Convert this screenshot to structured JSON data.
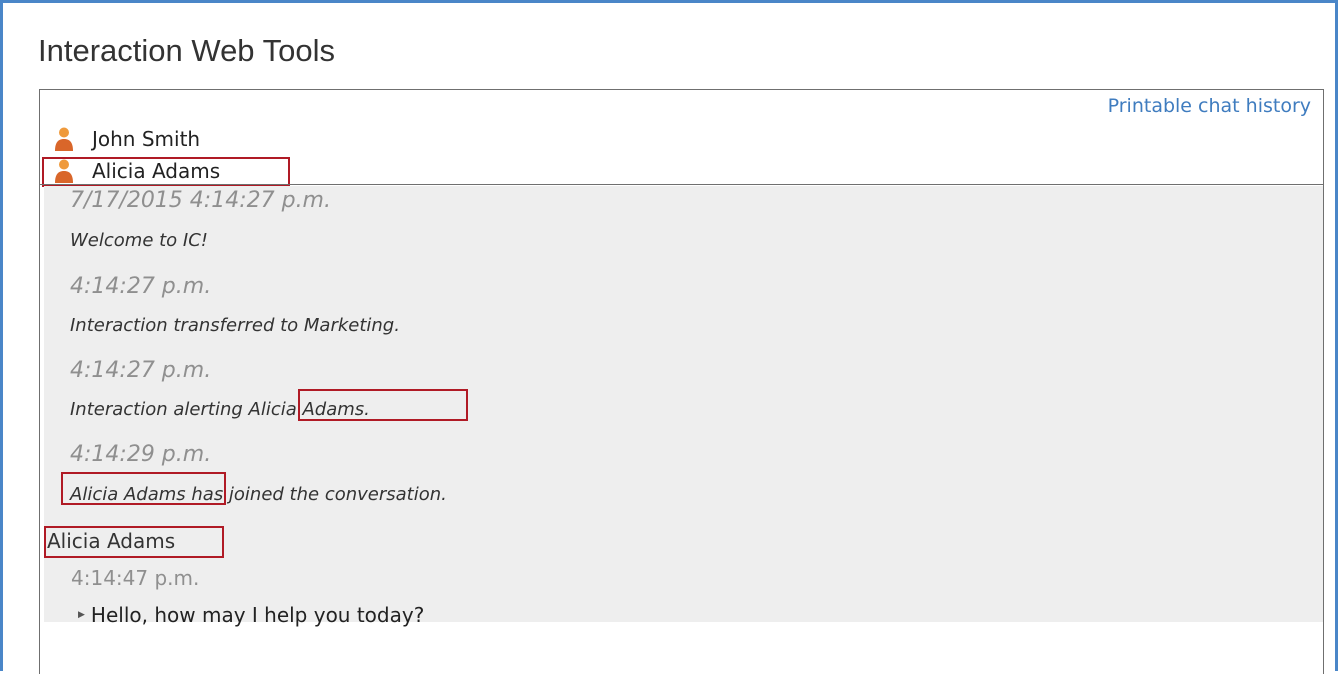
{
  "app": {
    "title": "Interaction Web Tools"
  },
  "toolbar": {
    "print_link": "Printable chat history"
  },
  "participants": [
    {
      "name": "John Smith",
      "icon": "person-icon"
    },
    {
      "name": "Alicia Adams",
      "icon": "person-icon"
    }
  ],
  "system_messages": [
    {
      "time": "7/17/2015 4:14:27 p.m.",
      "text": "Welcome to IC!"
    },
    {
      "time": "4:14:27 p.m.",
      "text": "Interaction transferred to Marketing."
    },
    {
      "time": "4:14:27 p.m.",
      "prefix": "Interaction alerting ",
      "name": "Alicia Adams."
    },
    {
      "time": "4:14:29 p.m.",
      "name": "Alicia Adams",
      "suffix": " has joined the conversation."
    }
  ],
  "agent_message": {
    "sender": "Alicia Adams",
    "time": "4:14:47 p.m.",
    "text": "Hello, how may I help you today?"
  },
  "colors": {
    "window_border": "#4a86c8",
    "link": "#3f7cbf",
    "highlight_box": "#b01a25",
    "system_background": "#eeeeee"
  }
}
